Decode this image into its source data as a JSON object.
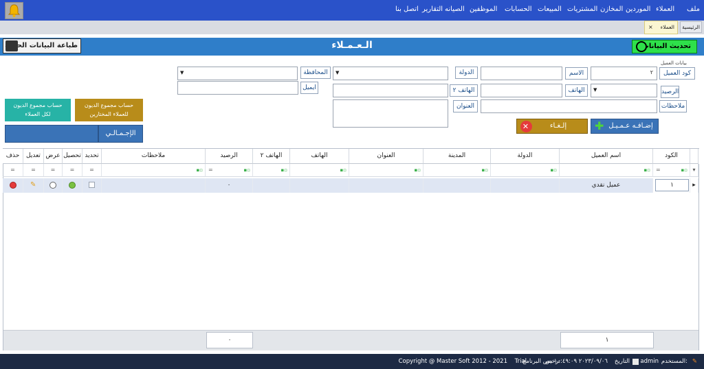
{
  "menu": {
    "items": [
      "ملف",
      "العملاء",
      "الموردين",
      "المخازن",
      "المشتريات",
      "المبيعات",
      "الحسابات",
      "الموظفين",
      "الصيانه",
      "التقارير",
      "اتصل بنا"
    ]
  },
  "tabs": {
    "home": "الرئيسية",
    "customers": "العملاء",
    "close": "×"
  },
  "header": {
    "title": "الـعـمـلاء",
    "refresh_label": "تحديث البيانات",
    "print_label": "طباعة البيانات الحاليه"
  },
  "form": {
    "group_label": "بيانات العميل",
    "code_label": "كود العميل",
    "code_value": "٢",
    "name_label": "الاسم",
    "country_label": "الدولة",
    "governorate_label": "المحافظة",
    "balance_label": "الرصيد",
    "phone_label": "الهاتف",
    "phone2_label": "الهاتف ٢",
    "email_label": "ايميل",
    "notes_label": "ملاحظات",
    "address_label": "العنوان"
  },
  "buttons": {
    "all_debt": [
      "حساب مجموع الديون",
      "لكل العملاء"
    ],
    "selected_debt": [
      "حساب مجموع الديون",
      "للعملاء المختارين"
    ],
    "total": "الإجـمـالـي",
    "add_customer": "إضـافـه عـمـيـل",
    "cancel": "إلـغـاء"
  },
  "table": {
    "columns": [
      "الكود",
      "اسم العميل",
      "الدولة",
      "المدينة",
      "العنوان",
      "الهاتف",
      "الهاتف ٢",
      "الرصيد",
      "ملاحظات",
      "تحديد",
      "تحصيل",
      "عرض",
      "تعديل",
      "حذف"
    ],
    "rows": [
      {
        "code": "١",
        "name": "عميل نقدي",
        "balance": "٠"
      }
    ]
  },
  "summary": {
    "count": "١",
    "balance_total": "٠"
  },
  "status": {
    "user_label": "المستخدم:",
    "user": "admin",
    "date_label": "التاريخ",
    "datetime": "٢٠٢٣/٠٩/٠٦ ١٠:٤٩:٠٩ ص",
    "license_label": "ترخيص البرنامج",
    "license": "Trial",
    "copyright": "Copyright @ Master Soft 2012 - 2021"
  },
  "colors": {
    "menu_bg": "#2a52c9",
    "title_bg": "#2f7ec9",
    "refresh_btn": "#2ee04a",
    "status_bg": "#1d2a44"
  }
}
